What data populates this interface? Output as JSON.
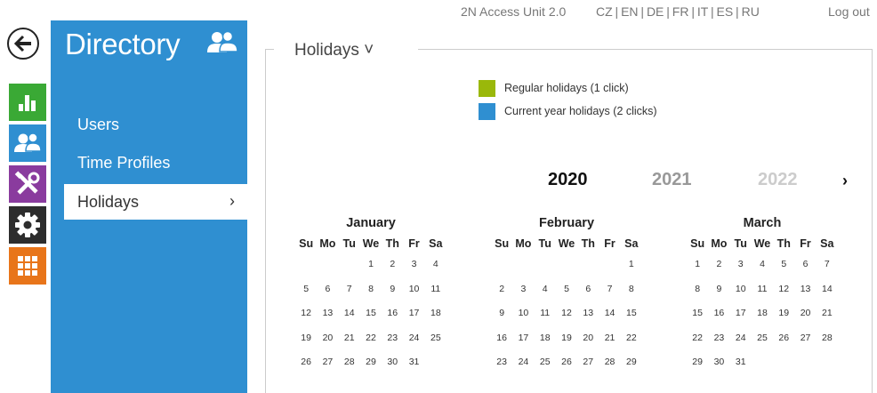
{
  "topbar": {
    "device": "2N Access Unit 2.0",
    "languages": "CZ | EN | DE | FR | IT | ES | RU",
    "logout": "Log out"
  },
  "sidebar": {
    "title": "Directory",
    "items": [
      {
        "label": "Users"
      },
      {
        "label": "Time Profiles"
      },
      {
        "label": "Holidays"
      }
    ]
  },
  "rail": {
    "colors": {
      "status": "#3aa935",
      "directory": "#2f8fd1",
      "hardware": "#8a3b9e",
      "services": "#2d2d2d",
      "system": "#e8751a"
    }
  },
  "panel": {
    "title": "Holidays ˅"
  },
  "legend": [
    {
      "label": "Regular holidays (1 click)",
      "color": "#9ab80a"
    },
    {
      "label": "Current year holidays (2 clicks)",
      "color": "#2f8fd1"
    }
  ],
  "years": {
    "current": "2020",
    "next": "2021",
    "after": "2022",
    "arrow": "›"
  },
  "weekdays": [
    "Su",
    "Mo",
    "Tu",
    "We",
    "Th",
    "Fr",
    "Sa"
  ],
  "months": [
    {
      "name": "January",
      "weeks": [
        [
          "",
          "",
          "",
          "1",
          "2",
          "3",
          "4"
        ],
        [
          "5",
          "6",
          "7",
          "8",
          "9",
          "10",
          "11"
        ],
        [
          "12",
          "13",
          "14",
          "15",
          "16",
          "17",
          "18"
        ],
        [
          "19",
          "20",
          "21",
          "22",
          "23",
          "24",
          "25"
        ],
        [
          "26",
          "27",
          "28",
          "29",
          "30",
          "31",
          ""
        ]
      ]
    },
    {
      "name": "February",
      "weeks": [
        [
          "",
          "",
          "",
          "",
          "",
          "",
          "1"
        ],
        [
          "2",
          "3",
          "4",
          "5",
          "6",
          "7",
          "8"
        ],
        [
          "9",
          "10",
          "11",
          "12",
          "13",
          "14",
          "15"
        ],
        [
          "16",
          "17",
          "18",
          "19",
          "20",
          "21",
          "22"
        ],
        [
          "23",
          "24",
          "25",
          "26",
          "27",
          "28",
          "29"
        ]
      ]
    },
    {
      "name": "March",
      "weeks": [
        [
          "1",
          "2",
          "3",
          "4",
          "5",
          "6",
          "7"
        ],
        [
          "8",
          "9",
          "10",
          "11",
          "12",
          "13",
          "14"
        ],
        [
          "15",
          "16",
          "17",
          "18",
          "19",
          "20",
          "21"
        ],
        [
          "22",
          "23",
          "24",
          "25",
          "26",
          "27",
          "28"
        ],
        [
          "29",
          "30",
          "31",
          "",
          "",
          "",
          ""
        ]
      ]
    }
  ]
}
